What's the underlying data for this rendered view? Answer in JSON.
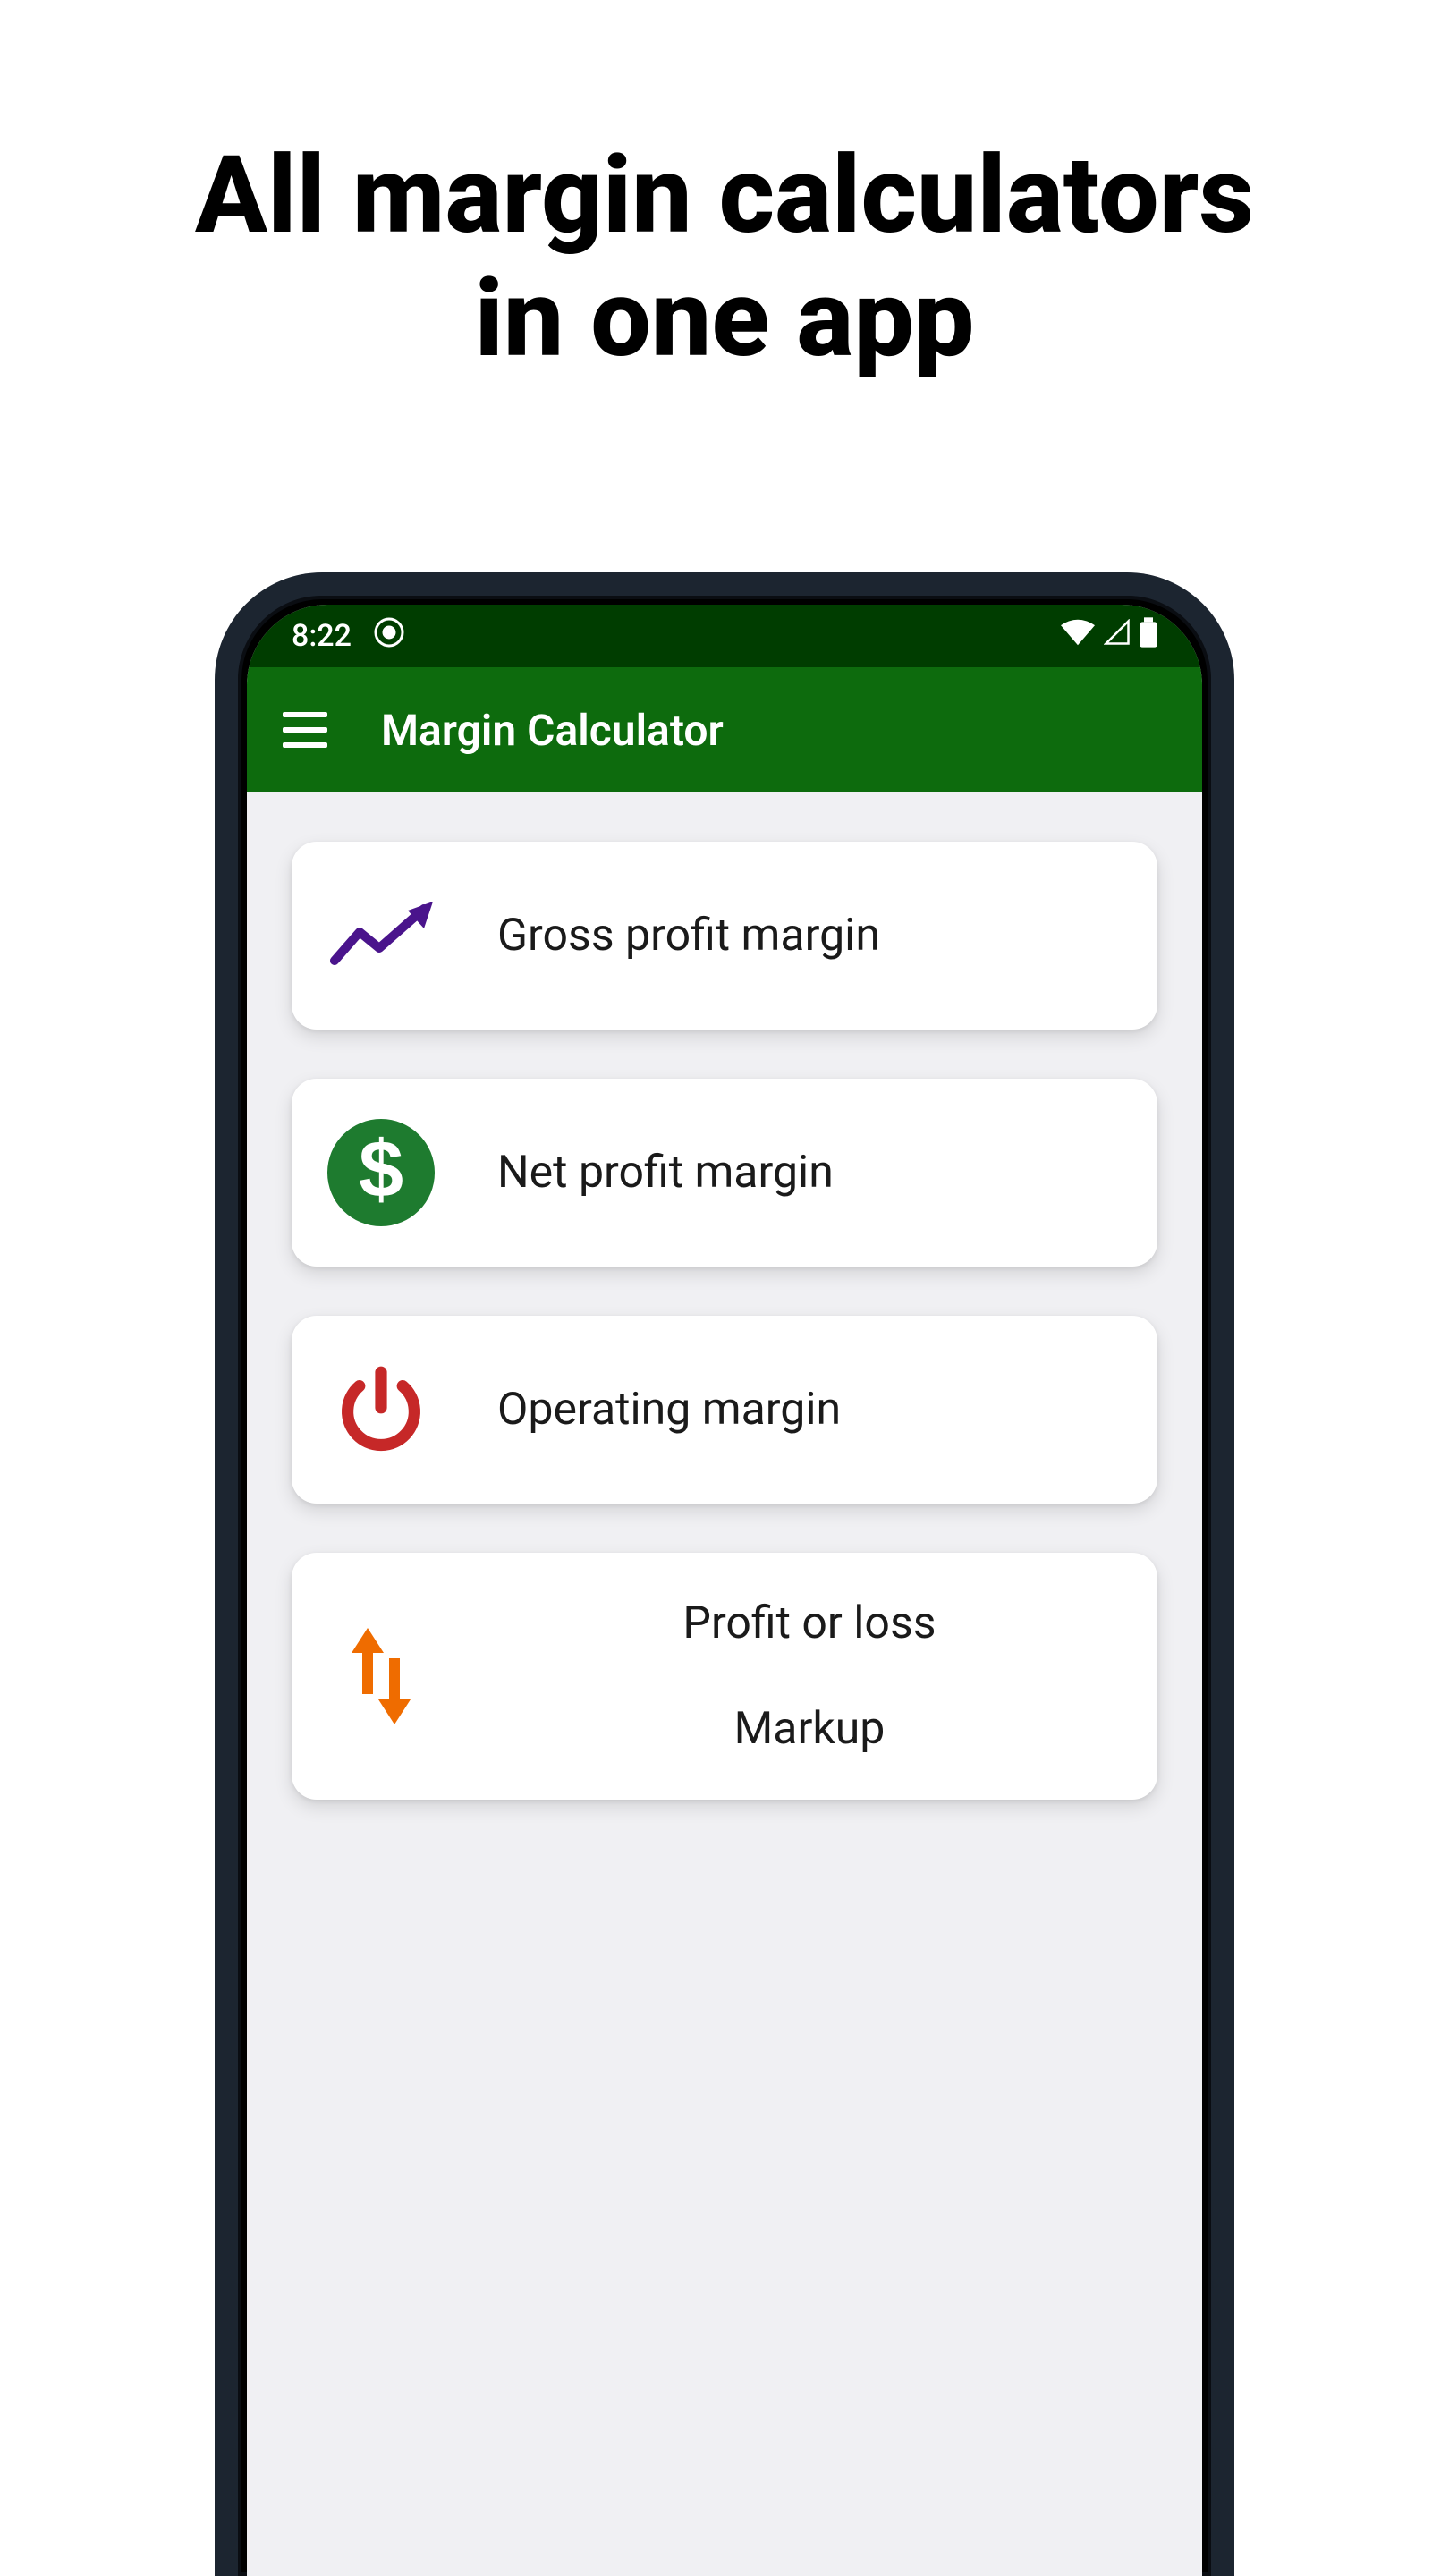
{
  "headline": {
    "line1": "All margin calculators",
    "line2": "in one app"
  },
  "status": {
    "time": "8:22"
  },
  "appbar": {
    "title": "Margin Calculator"
  },
  "cards": {
    "gross": {
      "label": "Gross profit margin",
      "icon": "trend-up-icon",
      "icon_color": "#4a148c"
    },
    "net": {
      "label": "Net profit margin",
      "icon": "dollar-badge-icon",
      "icon_color": "#1e7b2f"
    },
    "operating": {
      "label": "Operating margin",
      "icon": "power-icon",
      "icon_color": "#c62828"
    },
    "profitloss": {
      "label1": "Profit or loss",
      "label2": "Markup",
      "icon": "swap-vertical-icon",
      "icon_color": "#ef6c00"
    }
  }
}
